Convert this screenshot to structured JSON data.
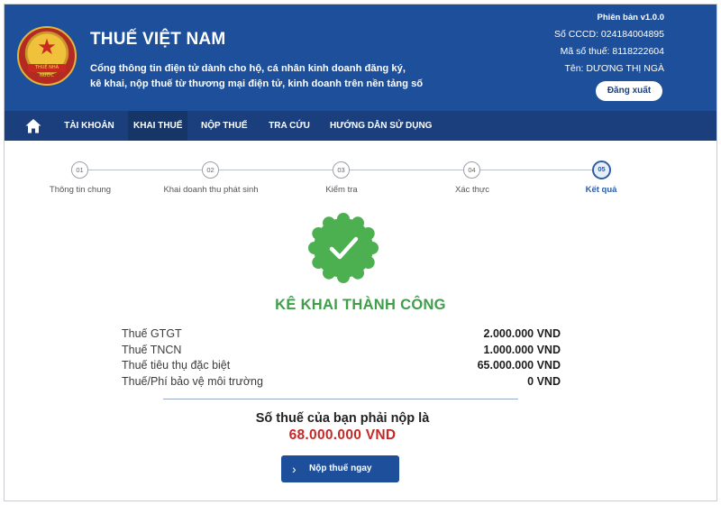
{
  "header": {
    "title": "THUẾ VIỆT NAM",
    "subtitle_line1": "Cổng thông tin điện tử dành cho hộ, cá nhân kinh doanh đăng ký,",
    "subtitle_line2": "kê khai, nộp thuế từ thương mại điện tử, kinh doanh trên nền tảng số",
    "version": "Phiên bản v1.0.0",
    "cccd": "Số CCCD: 024184004895",
    "tax_code": "Mã số thuế: 8118222604",
    "name": "Tên: DƯƠNG THỊ NGÀ",
    "logout_label": "Đăng xuất",
    "emblem_text": "THUẾ NHÀ NƯỚC"
  },
  "nav": {
    "items": [
      {
        "label": "TÀI KHOẢN"
      },
      {
        "label": "KHAI THUẾ"
      },
      {
        "label": "NỘP THUẾ"
      },
      {
        "label": "TRA CỨU"
      },
      {
        "label": "HƯỚNG DẪN SỬ DỤNG"
      }
    ],
    "active": "KHAI THUẾ"
  },
  "steps": [
    {
      "num": "01",
      "label": "Thông tin chung"
    },
    {
      "num": "02",
      "label": "Khai doanh thu phát sinh"
    },
    {
      "num": "03",
      "label": "Kiểm tra"
    },
    {
      "num": "04",
      "label": "Xác thực"
    },
    {
      "num": "05",
      "label": "Kết quả"
    }
  ],
  "result": {
    "title": "KÊ KHAI THÀNH CÔNG",
    "rows": [
      {
        "label": "Thuế GTGT",
        "value": "2.000.000 VND"
      },
      {
        "label": "Thuế TNCN",
        "value": "1.000.000 VND"
      },
      {
        "label": "Thuế tiêu thụ đặc biệt",
        "value": "65.000.000 VND"
      },
      {
        "label": "Thuế/Phí bảo vệ môi trường",
        "value": "0 VND"
      }
    ],
    "pay_label": "Số thuế của bạn phải nộp là",
    "pay_amount": "68.000.000 VND",
    "pay_button": "Nộp thuế ngay"
  },
  "colors": {
    "header_bg": "#1e4f9a",
    "nav_bg": "#1a3f7c",
    "success_green": "#3e9e4a",
    "amount_red": "#c62828"
  }
}
